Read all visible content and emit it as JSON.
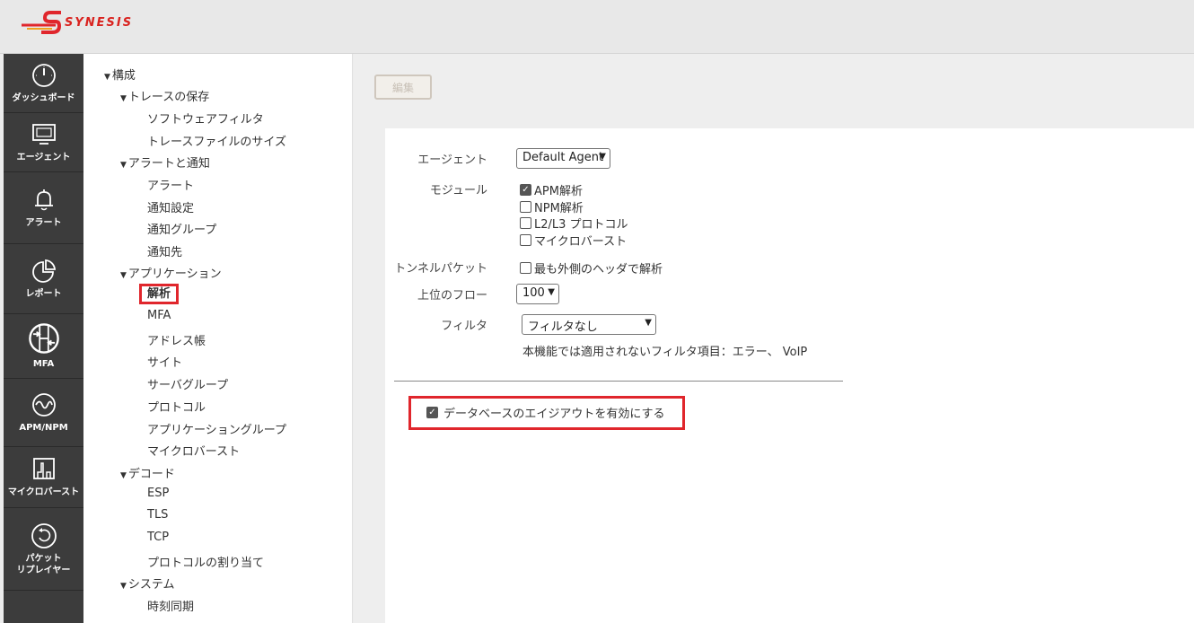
{
  "header": {
    "logo_text": "SYNESIS"
  },
  "nav": [
    {
      "name": "dashboard",
      "label": "ダッシュボード",
      "icon": "dashboard-gauge-icon"
    },
    {
      "name": "agent",
      "label": "エージェント",
      "icon": "monitor-icon"
    },
    {
      "name": "alert",
      "label": "アラート",
      "icon": "bell-icon"
    },
    {
      "name": "report",
      "label": "レポート",
      "icon": "pie-chart-icon"
    },
    {
      "name": "mfa",
      "label": "MFA",
      "icon": "mfa-arrows-icon"
    },
    {
      "name": "apm-npm",
      "label": "APM/NPM",
      "icon": "wave-icon"
    },
    {
      "name": "microburst",
      "label": "マイクロバースト",
      "icon": "burst-graph-icon"
    },
    {
      "name": "packet-replayer",
      "label_line1": "パケット",
      "label_line2": "リプレイヤー",
      "icon": "replay-icon"
    }
  ],
  "tree": {
    "root": "構成",
    "trace_save": "トレースの保存",
    "software_filter": "ソフトウェアフィルタ",
    "trace_file_size": "トレースファイルのサイズ",
    "alerts_notify": "アラートと通知",
    "alert": "アラート",
    "notify_settings": "通知設定",
    "notify_group": "通知グループ",
    "notify_dest": "通知先",
    "application": "アプリケーション",
    "analysis": "解析",
    "mfa": "MFA",
    "address_book": "アドレス帳",
    "site": "サイト",
    "server_group": "サーバグループ",
    "protocol": "プロトコル",
    "app_group": "アプリケーショングループ",
    "microburst": "マイクロバースト",
    "decode": "デコード",
    "esp": "ESP",
    "tls": "TLS",
    "tcp": "TCP",
    "protocol_assign": "プロトコルの割り当て",
    "system": "システム",
    "time_sync": "時刻同期"
  },
  "toolbar": {
    "edit_label": "編集"
  },
  "form": {
    "agent_label": "エージェント",
    "agent_value": "Default Agent",
    "module_label": "モジュール",
    "modules": [
      {
        "label": "APM解析",
        "checked": true
      },
      {
        "label": "NPM解析",
        "checked": false
      },
      {
        "label": "L2/L3 プロトコル",
        "checked": false
      },
      {
        "label": "マイクロバースト",
        "checked": false
      }
    ],
    "tunnel_label": "トンネルパケット",
    "tunnel_option": "最も外側のヘッダで解析",
    "top_flow_label": "上位のフロー",
    "top_flow_value": "100",
    "filter_label": "フィルタ",
    "filter_value": "フィルタなし",
    "filter_note": "本機能では適用されないフィルタ項目：エラー、 VoIP",
    "db_aging_label": "データベースのエイジアウトを有効にする"
  },
  "colors": {
    "accent_red": "#e0262c",
    "nav_bg": "#3c3c3c"
  }
}
